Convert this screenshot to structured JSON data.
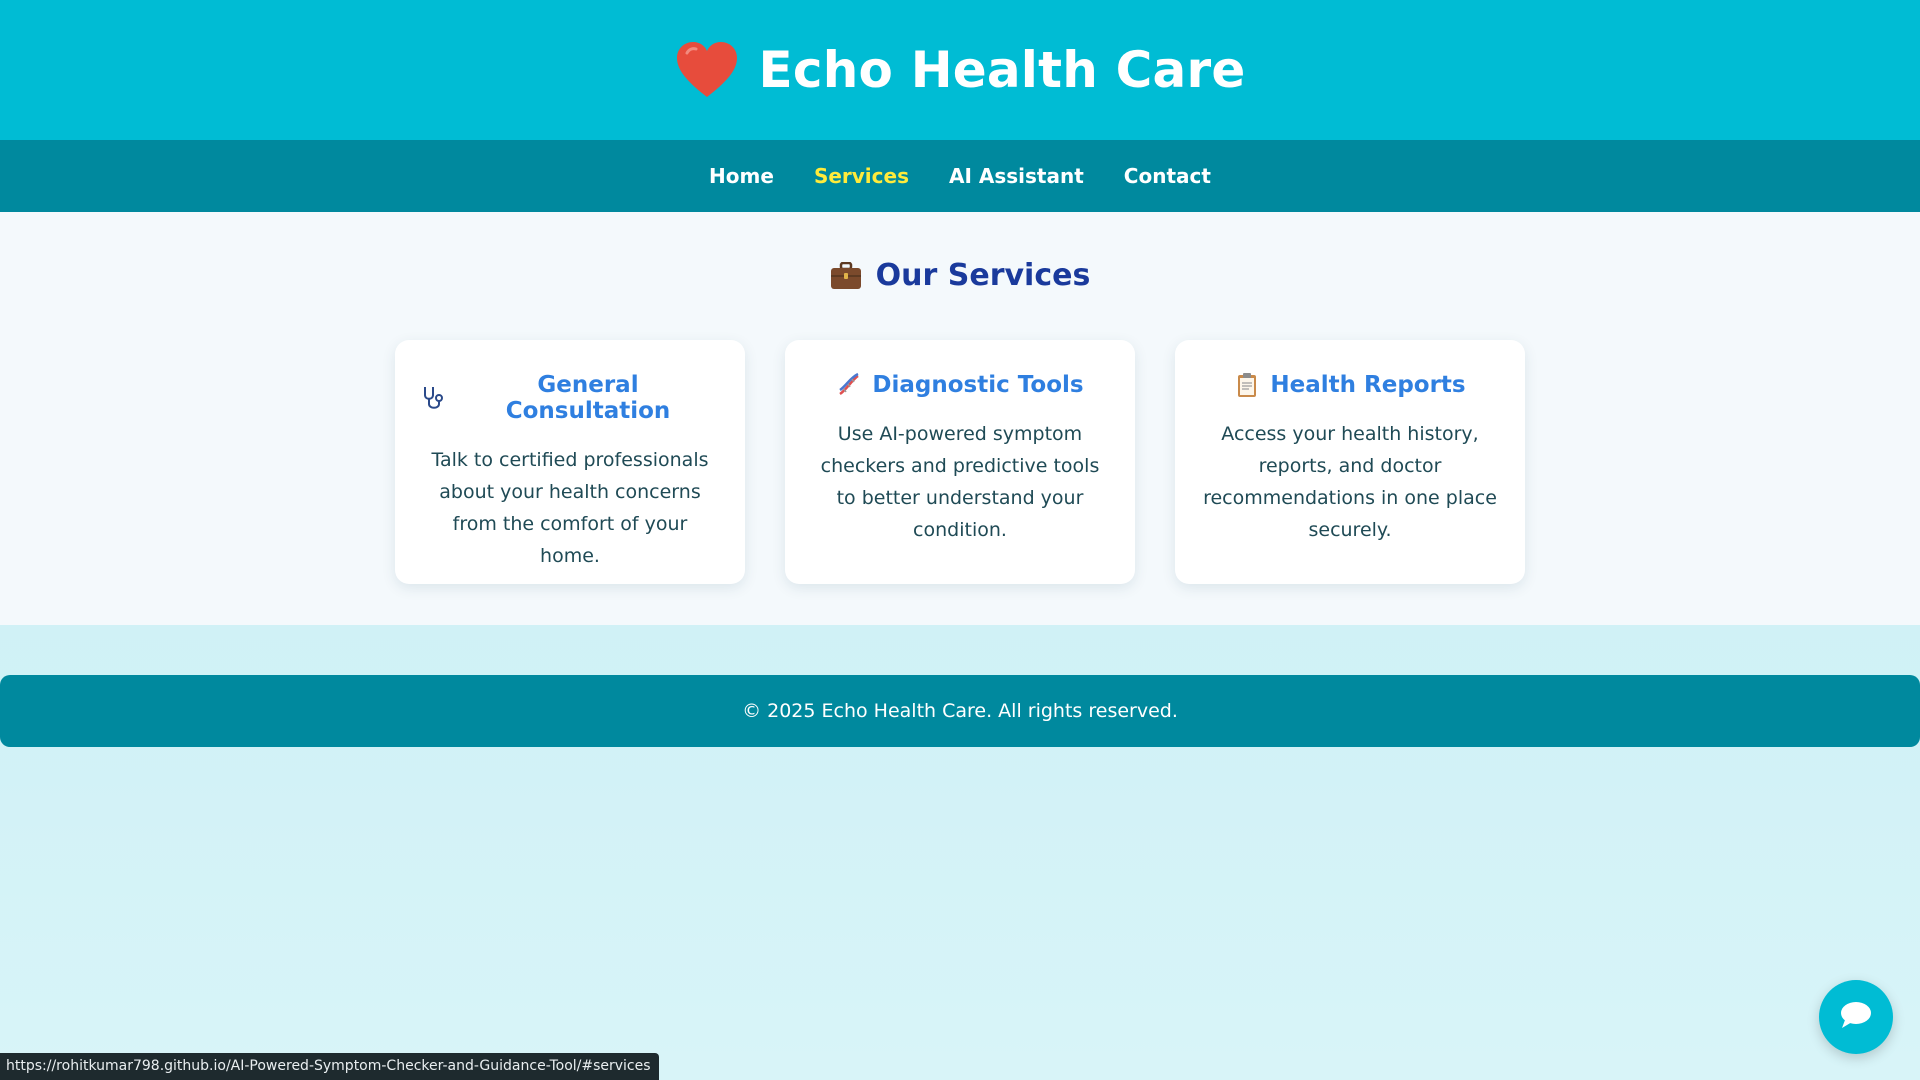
{
  "header": {
    "title": "Echo Health Care",
    "logo_icon": "heart-icon",
    "logo_color": "#e74c3c"
  },
  "nav": {
    "items": [
      {
        "label": "Home",
        "active": false
      },
      {
        "label": "Services",
        "active": true
      },
      {
        "label": "AI Assistant",
        "active": false
      },
      {
        "label": "Contact",
        "active": false
      }
    ]
  },
  "services": {
    "title": "Our Services",
    "title_icon": "briefcase-icon",
    "cards": [
      {
        "icon": "stethoscope-icon",
        "title": "General Consultation",
        "text": "Talk to certified professionals about your health concerns from the comfort of your home."
      },
      {
        "icon": "dna-icon",
        "title": "Diagnostic Tools",
        "text": "Use AI-powered symptom checkers and predictive tools to better understand your condition."
      },
      {
        "icon": "clipboard-icon",
        "title": "Health Reports",
        "text": "Access your health history, reports, and doctor recommendations in one place securely."
      }
    ]
  },
  "footer": {
    "text": "© 2025 Echo Health Care. All rights reserved."
  },
  "chat": {
    "icon": "chat-bubble-icon"
  },
  "status_bar": {
    "url": "https://rohitkumar798.github.io/AI-Powered-Symptom-Checker-and-Guidance-Tool/#services"
  },
  "colors": {
    "header_bg": "#00bcd4",
    "nav_bg": "#00899e",
    "nav_active": "#ffeb3b",
    "section_title": "#1a3a9c",
    "card_title": "#2f7fe0"
  }
}
